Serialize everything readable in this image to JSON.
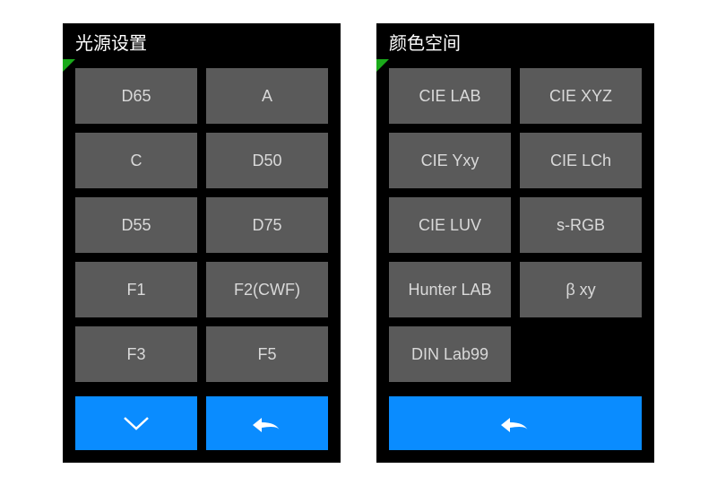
{
  "colors": {
    "accent": "#0a8cff",
    "indicator": "#1aaa1a",
    "cell": "#5a5a5a",
    "text": "#d9d9d9"
  },
  "left_panel": {
    "title": "光源设置",
    "options": [
      "D65",
      "A",
      "C",
      "D50",
      "D55",
      "D75",
      "F1",
      "F2(CWF)",
      "F3",
      "F5"
    ],
    "footer": {
      "down": true,
      "back": true
    }
  },
  "right_panel": {
    "title": "颜色空间",
    "options": [
      "CIE LAB",
      "CIE XYZ",
      "CIE Yxy",
      "CIE LCh",
      "CIE LUV",
      "s-RGB",
      "Hunter LAB",
      "β xy",
      "DIN Lab99"
    ],
    "footer": {
      "back_full": true
    }
  }
}
